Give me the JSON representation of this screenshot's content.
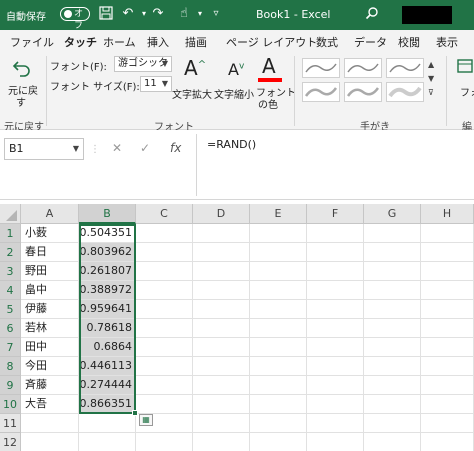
{
  "titlebar": {
    "autosave_label": "自動保存",
    "autosave_toggle": "オフ",
    "title": "Book1 - Excel"
  },
  "tabs": [
    "ファイル",
    "タッチ",
    "ホーム",
    "挿入",
    "描画",
    "ページ レイアウト",
    "数式",
    "データ",
    "校閲",
    "表示"
  ],
  "ribbon": {
    "undo_label_1": "元に戻",
    "undo_label_2": "す",
    "undo_group": "元に戻す",
    "font_label": "フォント(F):",
    "font_value": "游ゴシック",
    "size_label": "フォント サイズ(F):",
    "size_value": "11",
    "grow_label": "文字拡大",
    "shrink_label": "文字縮小",
    "color_label_1": "フォント",
    "color_label_2": "の色",
    "font_group": "フォント",
    "ink_group": "手がき",
    "right_clip_1": "フォ",
    "right_clip_2": "編"
  },
  "formula_bar": {
    "name_box": "B1",
    "fx": "fx",
    "formula": "=RAND()"
  },
  "grid": {
    "columns": [
      "A",
      "B",
      "C",
      "D",
      "E",
      "F",
      "G",
      "H"
    ],
    "rows": [
      "1",
      "2",
      "3",
      "4",
      "5",
      "6",
      "7",
      "8",
      "9",
      "10",
      "11",
      "12"
    ],
    "col_a": [
      "小薮",
      "春日",
      "野田",
      "畠中",
      "伊藤",
      "若林",
      "田中",
      "今田",
      "斉藤",
      "大吾"
    ],
    "col_b": [
      "0.504351",
      "0.803962",
      "0.261807",
      "0.388972",
      "0.959641",
      "0.78618",
      "0.6864",
      "0.446113",
      "0.274444",
      "0.866351"
    ]
  },
  "colors": {
    "accent": "#217346",
    "selection_fill": "#d6d6d6",
    "font_color_bar": "#ff0000"
  }
}
